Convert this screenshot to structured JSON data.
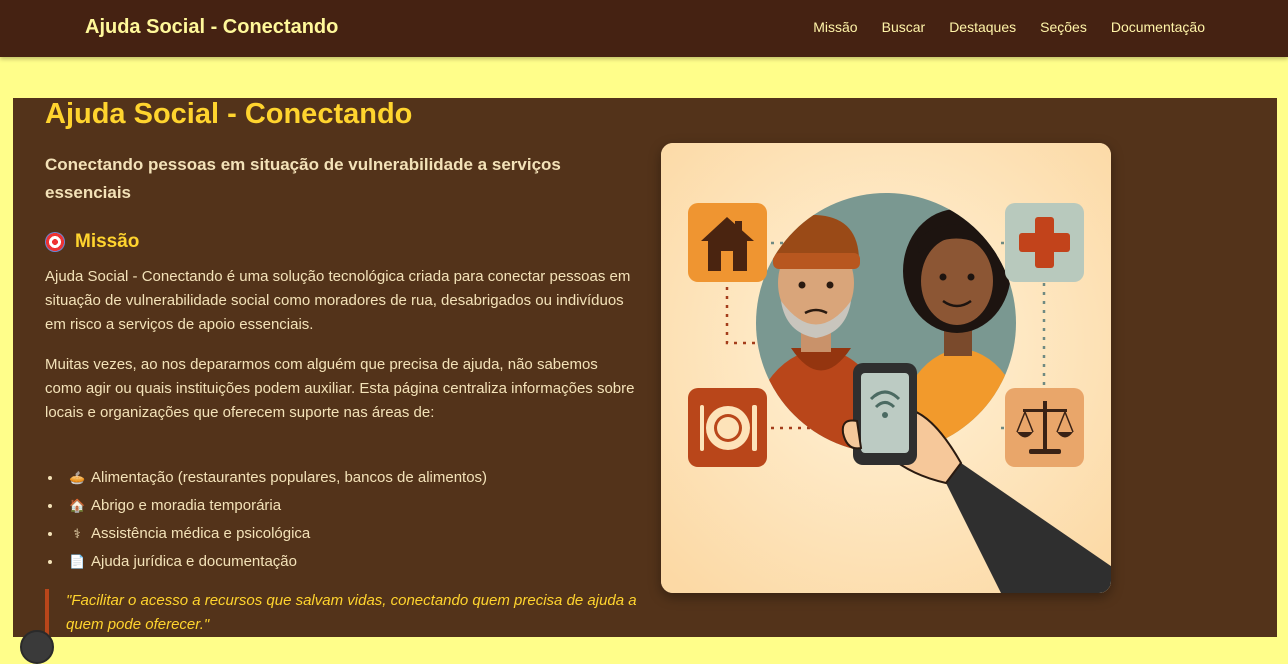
{
  "navbar": {
    "brand": "Ajuda Social - Conectando",
    "links": [
      "Missão",
      "Buscar",
      "Destaques",
      "Seções",
      "Documentação"
    ]
  },
  "hero": {
    "title": "Ajuda Social - Conectando",
    "subtitle": "Conectando pessoas em situação de vulnerabilidade a serviços essenciais"
  },
  "mission": {
    "heading": "Missão",
    "icon": "target-icon",
    "paragraph1": "Ajuda Social - Conectando é uma solução tecnológica criada para conectar pessoas em situação de vulnerabilidade social como moradores de rua, desabrigados ou indivíduos em risco a serviços de apoio essenciais.",
    "paragraph2": "Muitas vezes, ao nos depararmos com alguém que precisa de ajuda, não sabemos como agir ou quais instituições podem auxiliar. Esta página centraliza informações sobre locais e organizações que oferecem suporte nas áreas de:",
    "areas": [
      {
        "icon": "food-bowl-icon",
        "label": "Alimentação (restaurantes populares, bancos de alimentos)"
      },
      {
        "icon": "house-icon",
        "label": "Abrigo e moradia temporária"
      },
      {
        "icon": "medical-icon",
        "label": "Assistência médica e psicológica"
      },
      {
        "icon": "document-icon",
        "label": "Ajuda jurídica e documentação"
      }
    ],
    "quote": "\"Facilitar o acesso a recursos que salvam vidas, conectando quem precisa de ajuda a quem pode oferecer.\""
  },
  "colors": {
    "navbar_bg": "#452212",
    "page_bg": "#fffe8a",
    "main_bg": "#53331a",
    "accent": "#ffd42e",
    "text": "#f3e2b8"
  }
}
